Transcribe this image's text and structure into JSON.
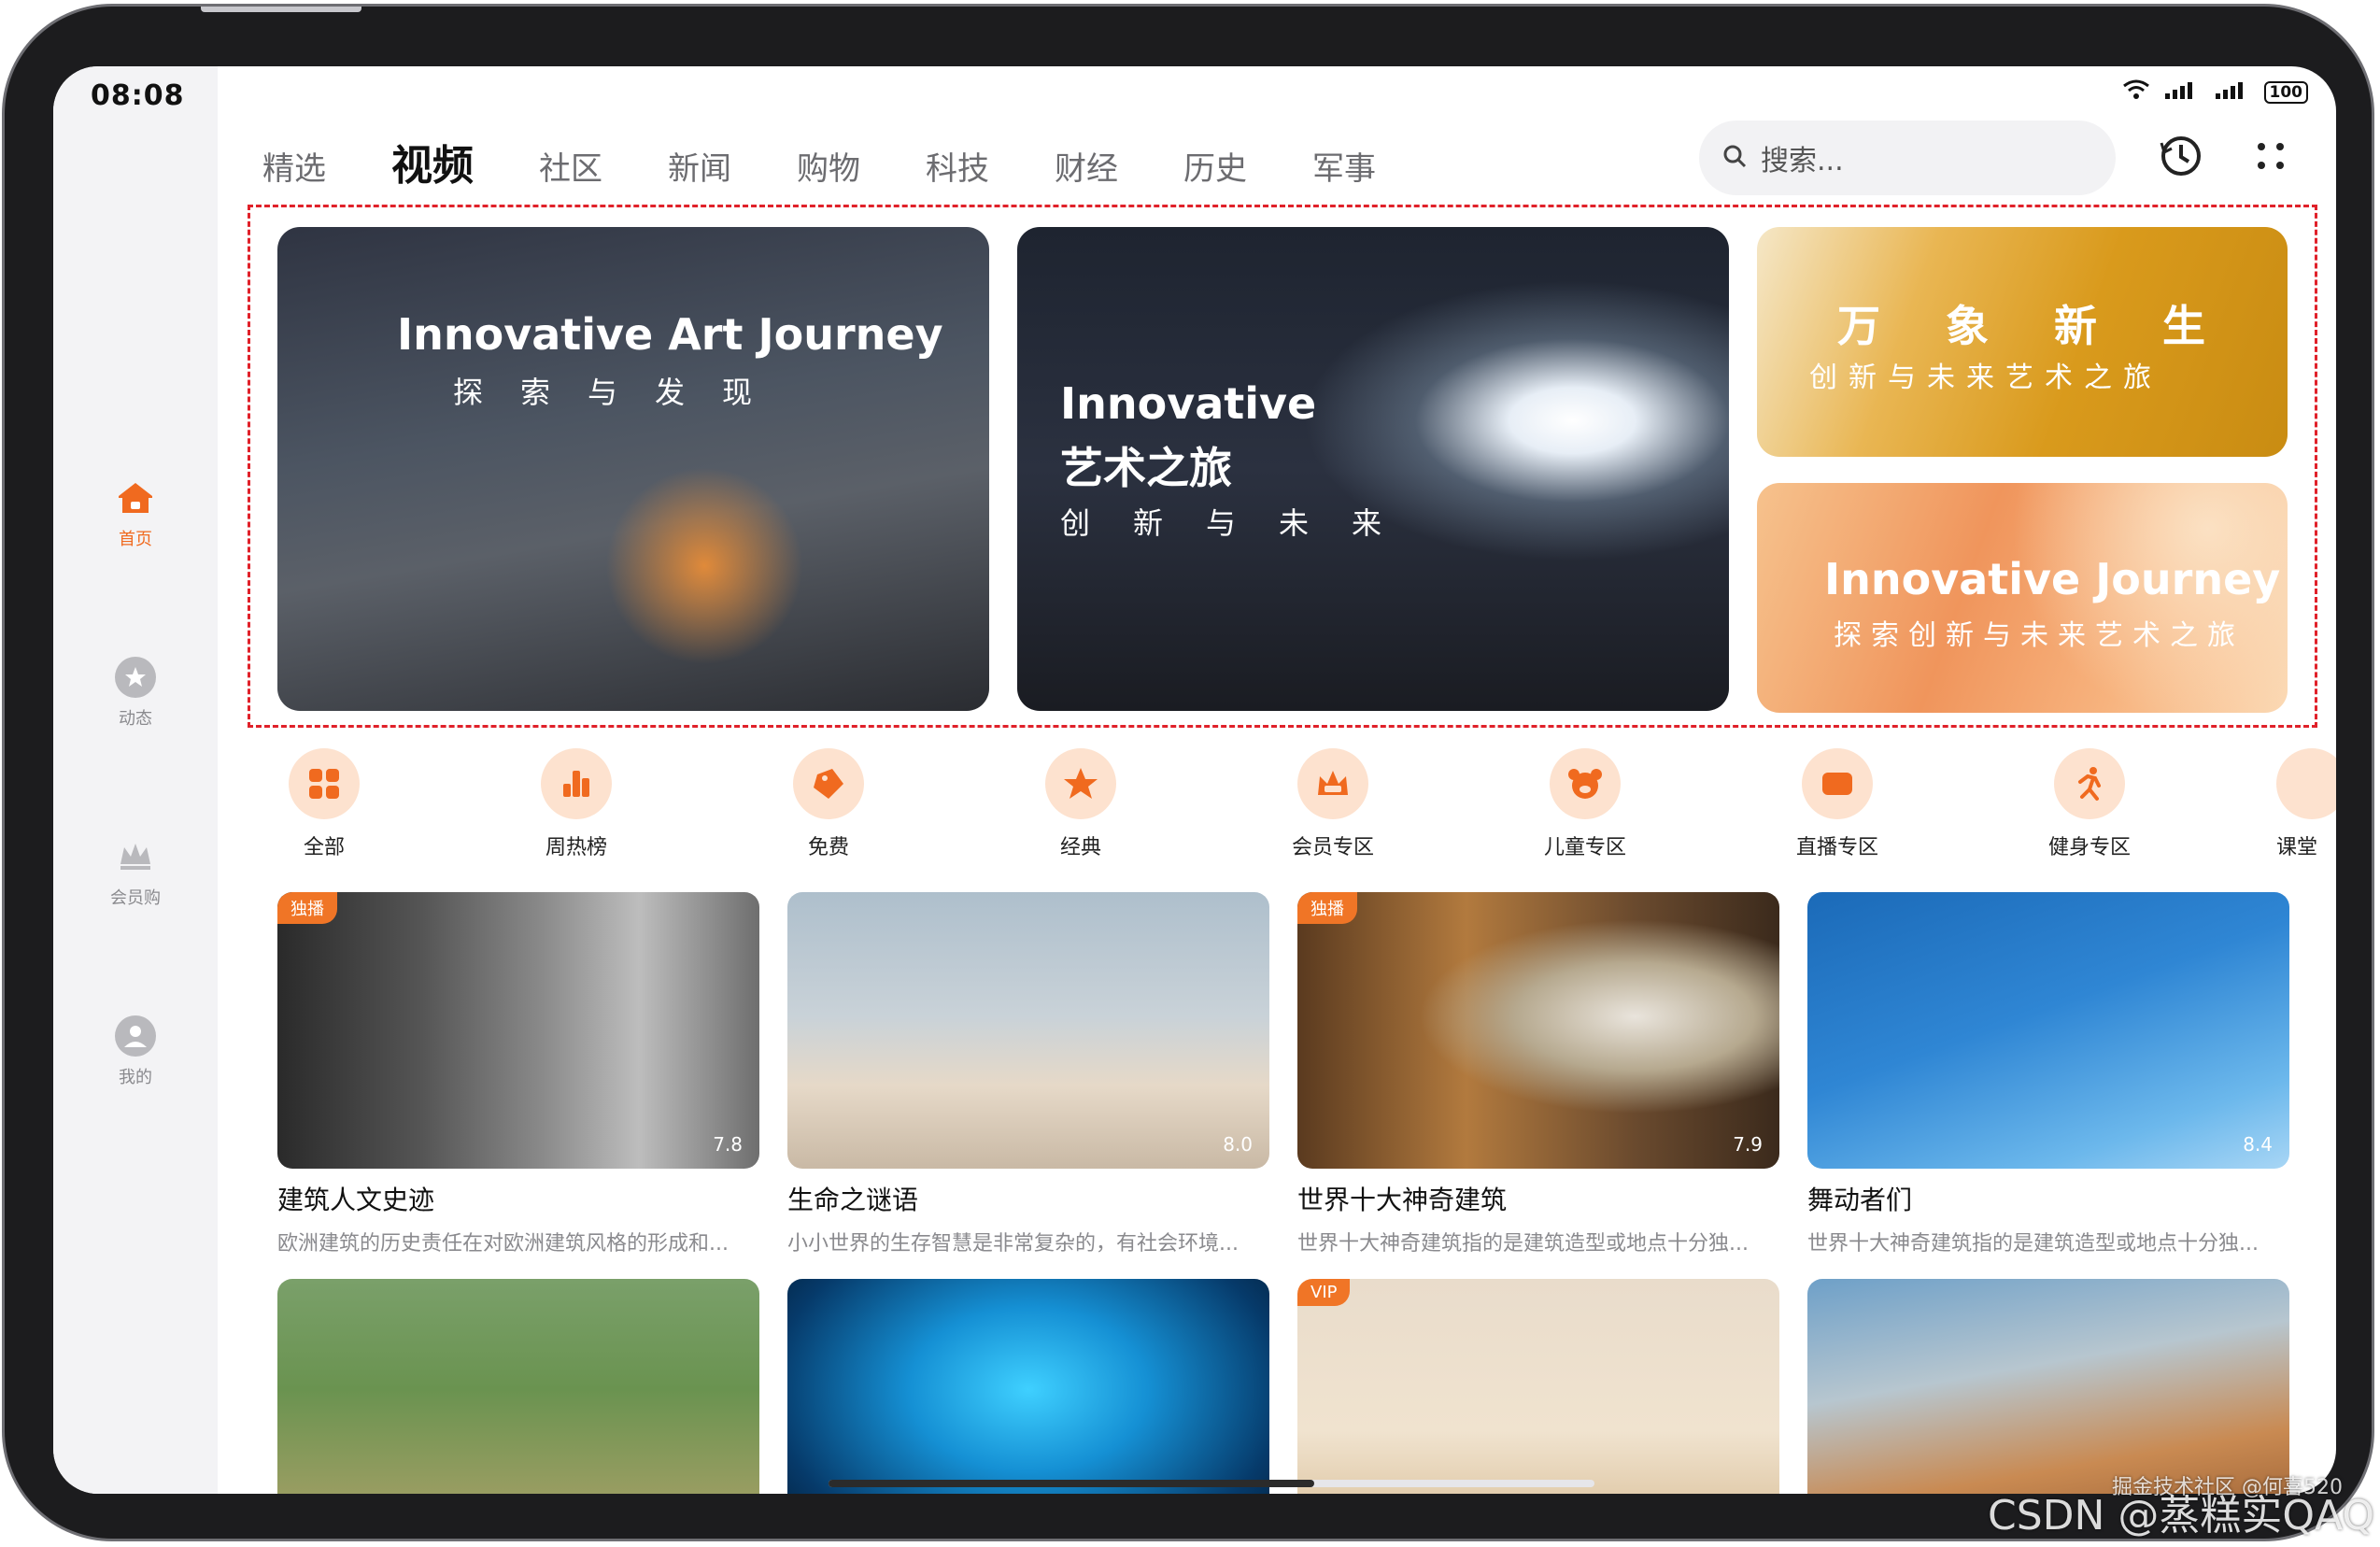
{
  "status": {
    "time": "08:08",
    "battery": "100"
  },
  "sidebar": {
    "items": [
      {
        "label": "首页",
        "icon": "home-icon",
        "active": true
      },
      {
        "label": "动态",
        "icon": "star-icon",
        "active": false
      },
      {
        "label": "会员购",
        "icon": "crown-icon",
        "active": false
      },
      {
        "label": "我的",
        "icon": "person-icon",
        "active": false
      }
    ]
  },
  "tabs": [
    "精选",
    "视频",
    "社区",
    "新闻",
    "购物",
    "科技",
    "财经",
    "历史",
    "军事"
  ],
  "active_tab": "视频",
  "search": {
    "placeholder": "搜索..."
  },
  "banners": [
    {
      "title": "Innovative Art Journey",
      "subtitle": "探索与发现"
    },
    {
      "title": "Innovative",
      "title2": "艺术之旅",
      "subtitle": "创新与未来"
    },
    {
      "title": "万象新生",
      "subtitle": "创新与未来艺术之旅"
    },
    {
      "title": "Innovative Journey",
      "subtitle": "探索创新与未来艺术之旅"
    }
  ],
  "categories": [
    {
      "label": "全部",
      "icon": "grid-icon"
    },
    {
      "label": "周热榜",
      "icon": "bar-chart-icon"
    },
    {
      "label": "免费",
      "icon": "ticket-icon"
    },
    {
      "label": "经典",
      "icon": "star-icon"
    },
    {
      "label": "会员专区",
      "icon": "vip-crown-icon"
    },
    {
      "label": "儿童专区",
      "icon": "bear-icon"
    },
    {
      "label": "直播专区",
      "icon": "video-camera-icon"
    },
    {
      "label": "健身专区",
      "icon": "running-icon"
    },
    {
      "label": "课堂",
      "icon": "class-icon"
    }
  ],
  "videos": [
    {
      "title": "建筑人文史迹",
      "desc": "欧洲建筑的历史责任在对欧洲建筑风格的形成和...",
      "score": "7.8",
      "badge": "独播"
    },
    {
      "title": "生命之谜语",
      "desc": "小小世界的生存智慧是非常复杂的，有社会环境...",
      "score": "8.0",
      "badge": ""
    },
    {
      "title": "世界十大神奇建筑",
      "desc": "世界十大神奇建筑指的是建筑造型或地点十分独...",
      "score": "7.9",
      "badge": "独播"
    },
    {
      "title": "舞动者们",
      "desc": "世界十大神奇建筑指的是建筑造型或地点十分独...",
      "score": "8.4",
      "badge": ""
    },
    {
      "badge": ""
    },
    {
      "badge": ""
    },
    {
      "badge": "VIP"
    },
    {
      "badge": ""
    }
  ],
  "watermark": {
    "main": "CSDN @蒸糕实QAQ",
    "small": "掘金技术社区 @何喜520"
  },
  "colors": {
    "accent": "#f06a1f",
    "banner_border": "#e0212a"
  }
}
